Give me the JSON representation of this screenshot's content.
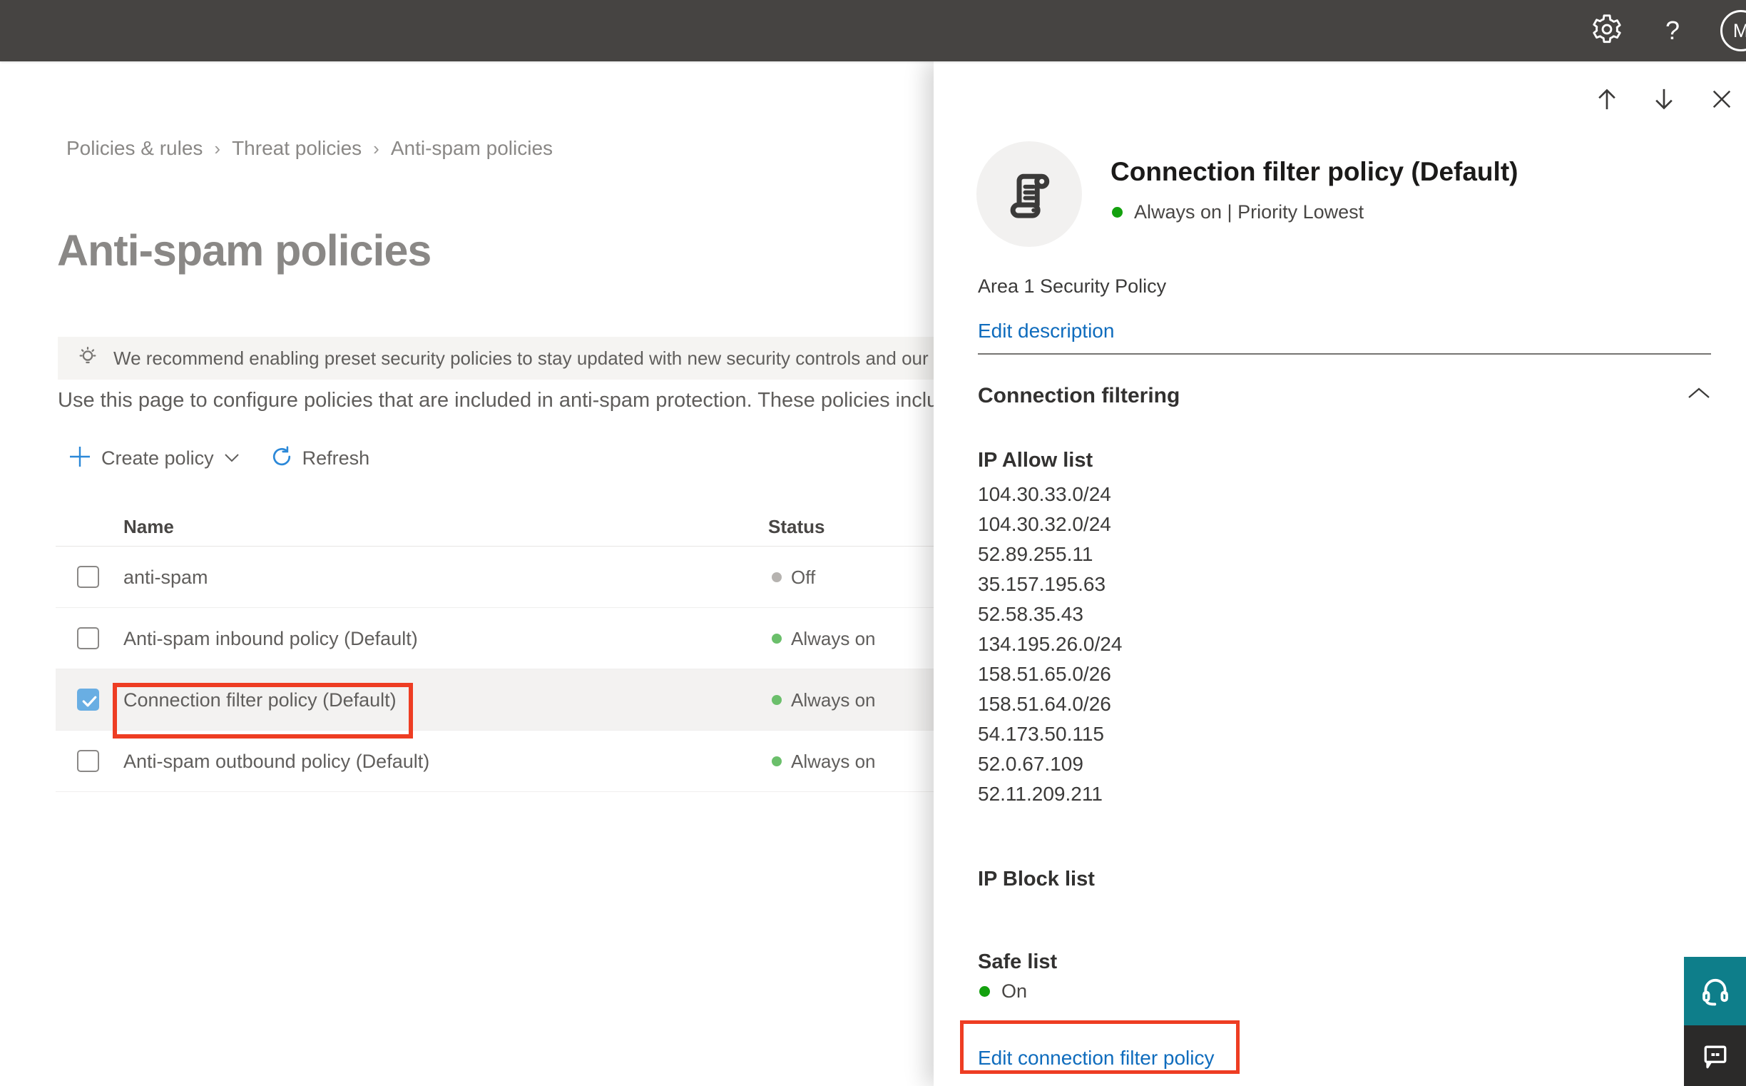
{
  "topbar": {
    "help_label": "?",
    "avatar_initial": "M"
  },
  "breadcrumb": {
    "separator": "›",
    "items": [
      "Policies & rules",
      "Threat policies",
      "Anti-spam policies"
    ]
  },
  "page": {
    "title": "Anti-spam policies",
    "banner_text": "We recommend enabling preset security policies to stay updated with new security controls and our recomme",
    "description": "Use this page to configure policies that are included in anti-spam protection. These policies include"
  },
  "toolbar": {
    "create_policy_label": "Create policy",
    "refresh_label": "Refresh"
  },
  "table": {
    "columns": [
      "Name",
      "Status"
    ],
    "rows": [
      {
        "name": "anti-spam",
        "status": "Off",
        "checked": false,
        "selected": false
      },
      {
        "name": "Anti-spam inbound policy (Default)",
        "status": "Always on",
        "checked": false,
        "selected": false
      },
      {
        "name": "Connection filter policy (Default)",
        "status": "Always on",
        "checked": true,
        "selected": true,
        "annotated": true
      },
      {
        "name": "Anti-spam outbound policy (Default)",
        "status": "Always on",
        "checked": false,
        "selected": false
      }
    ]
  },
  "panel": {
    "title": "Connection filter policy (Default)",
    "status_line": "Always on | Priority Lowest",
    "description": "Area 1 Security Policy",
    "edit_description_label": "Edit description",
    "section_title": "Connection filtering",
    "ip_allow_title": "IP Allow list",
    "ip_allow_items": [
      "104.30.33.0/24",
      "104.30.32.0/24",
      "52.89.255.11",
      "35.157.195.63",
      "52.58.35.43",
      "134.195.26.0/24",
      "158.51.65.0/26",
      "158.51.64.0/26",
      "54.173.50.115",
      "52.0.67.109",
      "52.11.209.211"
    ],
    "ip_block_title": "IP Block list",
    "safe_list_title": "Safe list",
    "safe_list_status": "On",
    "edit_link_label": "Edit connection filter policy"
  },
  "colors": {
    "topbar-bg": "#464442",
    "accent-blue": "#2b88d8",
    "link-blue": "#0f6cbd",
    "checkbox-blue": "#69aee3",
    "annotation-red": "#ee3d23",
    "status-on-green": "#6bbf6b",
    "status-off-gray": "#b6b3b0",
    "panel-green": "#13a10e",
    "support-teal": "#0e7e8a",
    "feedback-dark": "#2b2a29"
  }
}
